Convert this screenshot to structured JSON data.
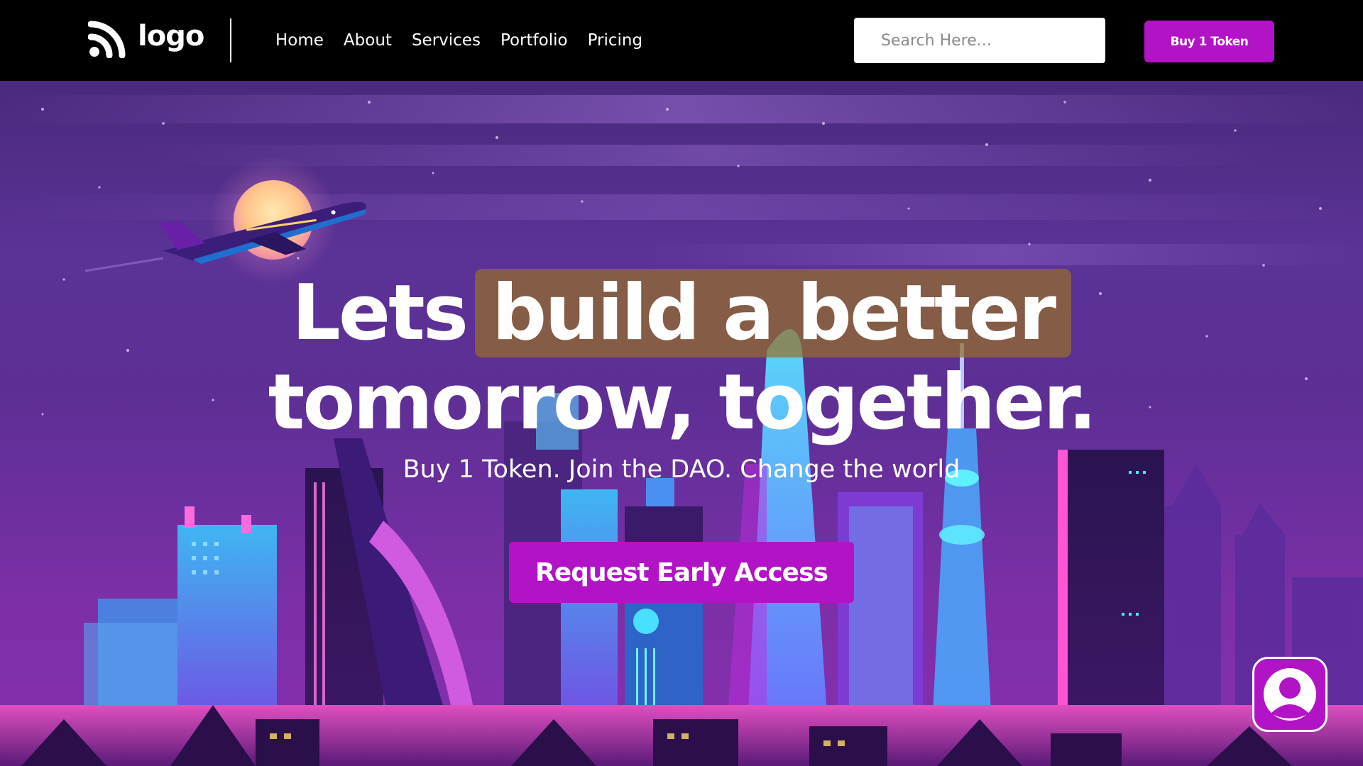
{
  "header": {
    "logo_text": "logo",
    "nav": [
      "Home",
      "About",
      "Services",
      "Portfolio",
      "Pricing"
    ],
    "search_placeholder": "Search Here...",
    "buy_button_label": "Buy 1 Token"
  },
  "hero": {
    "headline_line1_plain": "Lets",
    "headline_line1_highlight": "build a better",
    "headline_line2": "tomorrow, together.",
    "tagline": "Buy 1 Token. Join the DAO. Change the world",
    "cta_label": "Request Early Access",
    "background_image": "neon-city-skyline-at-night-with-airplane-and-moon"
  },
  "colors": {
    "accent": "#b313c6",
    "header_bg": "#000000",
    "highlight_bg": "#966e28"
  },
  "icons": {
    "logo": "wifi-signal-logo-icon",
    "avatar": "user-avatar-icon"
  }
}
